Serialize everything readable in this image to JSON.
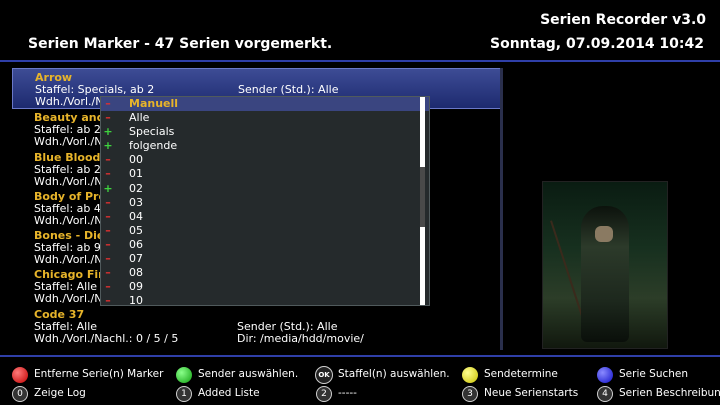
{
  "header": {
    "app_title": "Serien Recorder v3.0",
    "subtitle": "Serien Marker - 47 Serien vorgemerkt.",
    "datetime": "Sonntag, 07.09.2014  10:42"
  },
  "list": [
    {
      "name": "Arrow",
      "line1": "Staffel: Specials, ab 2",
      "line1b": "Sender (Std.): Alle",
      "line2": "Wdh./Vorl./N",
      "line2b": ""
    },
    {
      "name": "Beauty and t",
      "line1": "Staffel: ab 2",
      "line1b": "",
      "line2": "Wdh./Vorl./N",
      "line2b": ""
    },
    {
      "name": "Blue Bloods",
      "line1": "Staffel: ab 2",
      "line1b": "",
      "line2": "Wdh./Vorl./N",
      "line2b": ""
    },
    {
      "name": "Body of Proo",
      "line1": "Staffel: ab 4",
      "line1b": "",
      "line2": "Wdh./Vorl./N",
      "line2b": ""
    },
    {
      "name": "Bones - Die K",
      "line1": "Staffel: ab 9",
      "line1b": "",
      "line2": "Wdh./Vorl./N",
      "line2b": ""
    },
    {
      "name": "Chicago Fire",
      "line1": "Staffel: Alle",
      "line1b": "",
      "line2": "Wdh./Vorl./N",
      "line2b": ""
    },
    {
      "name": "Code 37",
      "line1": "Staffel: Alle",
      "line1b": "Sender (Std.): Alle",
      "line2": "Wdh./Vorl./Nachl.: 0 / 5 / 5",
      "line2b": "Dir: /media/hdd/movie/"
    }
  ],
  "popup": {
    "items": [
      {
        "label": "Manuell",
        "mark": "–",
        "mark_color": "red",
        "selected": true
      },
      {
        "label": "Alle",
        "mark": "–",
        "mark_color": "red"
      },
      {
        "label": "Specials",
        "mark": "+",
        "mark_color": "green"
      },
      {
        "label": "folgende",
        "mark": "+",
        "mark_color": "green"
      },
      {
        "label": "00",
        "mark": "–",
        "mark_color": "red"
      },
      {
        "label": "01",
        "mark": "–",
        "mark_color": "red"
      },
      {
        "label": "02",
        "mark": "+",
        "mark_color": "green"
      },
      {
        "label": "03",
        "mark": "–",
        "mark_color": "red"
      },
      {
        "label": "04",
        "mark": "–",
        "mark_color": "red"
      },
      {
        "label": "05",
        "mark": "–",
        "mark_color": "red"
      },
      {
        "label": "06",
        "mark": "–",
        "mark_color": "red"
      },
      {
        "label": "07",
        "mark": "–",
        "mark_color": "red"
      },
      {
        "label": "08",
        "mark": "–",
        "mark_color": "red"
      },
      {
        "label": "09",
        "mark": "–",
        "mark_color": "red"
      },
      {
        "label": "10",
        "mark": "–",
        "mark_color": "red"
      }
    ]
  },
  "footer": {
    "red": "Entferne Serie(n) Marker",
    "green": "Sender auswählen.",
    "ok": "Staffel(n) auswählen.",
    "ok_key": "OK",
    "yellow": "Sendetermine",
    "blue": "Serie Suchen",
    "k0": "Zeige Log",
    "k0_key": "0",
    "k1": "Added Liste",
    "k1_key": "1",
    "k2": "-----",
    "k2_key": "2",
    "k3": "Neue Serienstarts",
    "k3_key": "3",
    "k4": "Serien Beschreibung",
    "k4_key": "4"
  },
  "colors": {
    "accent": "#2f3fa8",
    "highlight": "#e7b42a",
    "selection": "#3d4c95"
  }
}
